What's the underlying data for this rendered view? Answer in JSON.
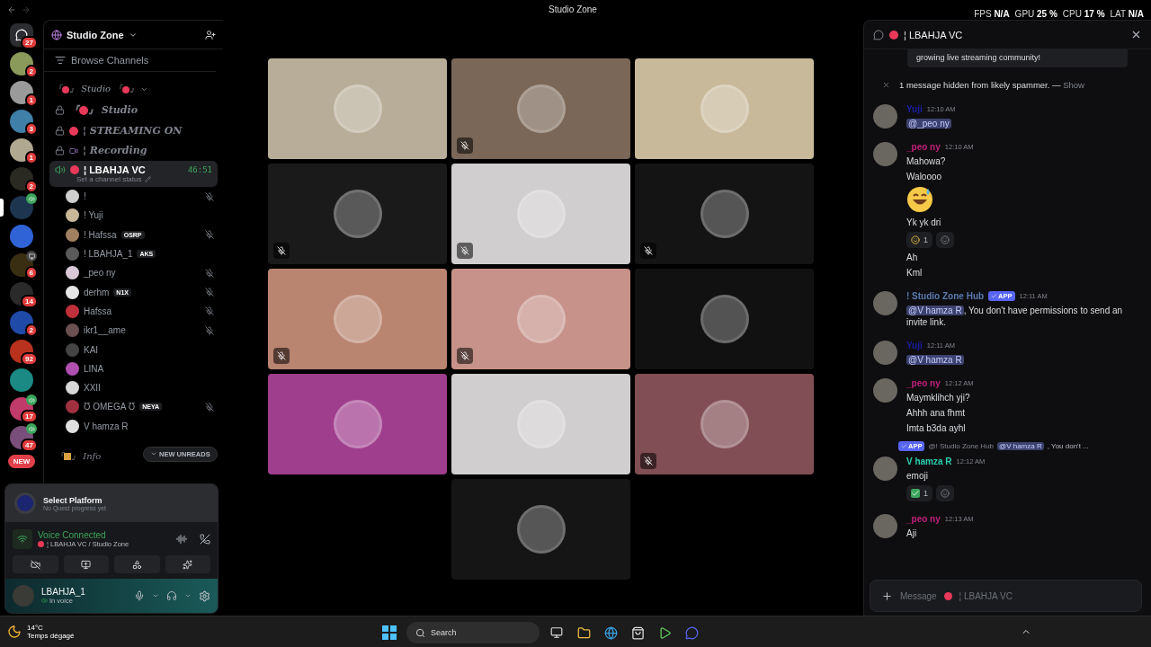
{
  "titlebar": {
    "title": "Studio Zone",
    "stats": [
      {
        "label": "FPS",
        "value": "N/A"
      },
      {
        "label": "GPU",
        "value": "25 %"
      },
      {
        "label": "CPU",
        "value": "17 %"
      },
      {
        "label": "LAT",
        "value": "N/A"
      }
    ]
  },
  "servers": [
    {
      "kind": "home",
      "badge": "27",
      "selected": false,
      "in_voice": false,
      "streaming": false
    },
    {
      "kind": "server",
      "color": "#8a9a5a",
      "badge": "2",
      "selected": false,
      "in_voice": false,
      "streaming": false
    },
    {
      "kind": "server",
      "color": "#9a9a9a",
      "badge": "1",
      "selected": false,
      "in_voice": false,
      "streaming": false
    },
    {
      "kind": "server",
      "color": "#3f7fa8",
      "badge": "3",
      "selected": false,
      "in_voice": false,
      "streaming": false
    },
    {
      "kind": "server",
      "color": "#b0a890",
      "badge": "1",
      "selected": false,
      "in_voice": false,
      "streaming": false
    },
    {
      "kind": "server",
      "color": "#2a2a22",
      "badge": "2",
      "selected": false,
      "in_voice": false,
      "streaming": false
    },
    {
      "kind": "server",
      "color": "#1e3550",
      "selected": true,
      "in_voice": true,
      "streaming": false
    },
    {
      "kind": "server",
      "color": "#2f63d6",
      "selected": false,
      "in_voice": false,
      "streaming": false
    },
    {
      "kind": "server",
      "color": "#3a2e12",
      "badge": "6",
      "selected": false,
      "in_voice": false,
      "streaming": true
    },
    {
      "kind": "server",
      "color": "#2a2a2a",
      "badge": "14",
      "selected": false,
      "in_voice": false,
      "streaming": false
    },
    {
      "kind": "server",
      "color": "#1f4aa8",
      "badge": "2",
      "selected": false,
      "in_voice": false,
      "streaming": false
    },
    {
      "kind": "server",
      "color": "#b8321e",
      "badge": "92",
      "selected": false,
      "in_voice": false,
      "streaming": false
    },
    {
      "kind": "server",
      "color": "#1c8a84",
      "selected": false,
      "in_voice": false,
      "streaming": false
    },
    {
      "kind": "server",
      "color": "#c03a6a",
      "badge": "17",
      "selected": false,
      "in_voice": true,
      "streaming": false
    },
    {
      "kind": "server",
      "color": "#7a4e7a",
      "badge": "47",
      "selected": false,
      "in_voice": true,
      "streaming": false
    }
  ],
  "new_servers_label": "NEW",
  "sidebar": {
    "server_name": "Studio Zone",
    "browse": "Browse Channels",
    "channels": [
      {
        "kind": "category",
        "name": "Studio",
        "brackets": [
          "『",
          "』"
        ],
        "expanded": true
      },
      {
        "kind": "bracketed",
        "locked": true,
        "brackets": [
          "『",
          "』"
        ],
        "name": "Studio"
      },
      {
        "kind": "text",
        "locked": true,
        "separator": "¦",
        "name": "STREAMING ON"
      },
      {
        "kind": "camera",
        "locked": true,
        "separator": "¦",
        "name": "Recording"
      },
      {
        "kind": "voice",
        "separator": "¦",
        "name": "LBAHJA VC",
        "timer": "46:51",
        "status": "Set a channel status",
        "selected": true
      }
    ],
    "members": [
      {
        "name": "!",
        "color": "#cfcfcf",
        "deafened": true
      },
      {
        "name": "! Yuji",
        "color": "#c9b79a",
        "deafened": false
      },
      {
        "name": "! Hafssa",
        "color": "#a08060",
        "tag": "OSRP",
        "deafened": true
      },
      {
        "name": "! LBAHJA_1",
        "color": "#5a5a5a",
        "tag": "AKS",
        "deafened": false
      },
      {
        "name": "_peo ny",
        "color": "#d8c8d8",
        "deafened": true
      },
      {
        "name": "derhm",
        "color": "#e6e6e6",
        "tag": "N1X",
        "deafened": true
      },
      {
        "name": "Hafssa",
        "color": "#c0303a",
        "deafened": true
      },
      {
        "name": "ikr1__ame",
        "color": "#6a5050",
        "deafened": true
      },
      {
        "name": "KAI",
        "color": "#444444",
        "deafened": false
      },
      {
        "name": "LINA",
        "color": "#b050b0",
        "deafened": false
      },
      {
        "name": "XXII",
        "color": "#d8d8d8",
        "deafened": false
      },
      {
        "name": "Ʊ OMEGA Ʊ",
        "color": "#a03040",
        "tag": "NEYA",
        "deafened": true
      },
      {
        "name": "V hamza R",
        "color": "#e0e0e0",
        "deafened": false
      }
    ],
    "info_channel": {
      "brackets": [
        "『",
        "』"
      ],
      "name": "Info"
    },
    "new_unreads": "NEW UNREADS"
  },
  "quest": {
    "title": "Select Platform",
    "subtitle": "No Quest progress yet"
  },
  "voice": {
    "status": "Voice Connected",
    "channel": "¦ LBAHJA VC / Studio Zone"
  },
  "user": {
    "name": "LBAHJA_1",
    "status": "In voice"
  },
  "tiles": [
    {
      "color": "#b8ad98",
      "muted": false
    },
    {
      "color": "#7a6757",
      "muted": true
    },
    {
      "color": "#c8b99a",
      "muted": false
    },
    {
      "color": "#1a1a1a",
      "muted": true
    },
    {
      "color": "#d0cece",
      "muted": true
    },
    {
      "color": "#141414",
      "muted": true
    },
    {
      "color": "#b98470",
      "muted": true
    },
    {
      "color": "#c7928a",
      "muted": true
    },
    {
      "color": "#111111",
      "muted": false
    },
    {
      "color": "#a03e8e",
      "muted": false
    },
    {
      "color": "#d0cecf",
      "muted": false
    },
    {
      "color": "#824e55",
      "muted": true
    },
    {
      "color": "#151515",
      "muted": false
    }
  ],
  "chat": {
    "title": "¦ LBAHJA VC",
    "embed_text": "growing live streaming community!",
    "hidden_notice": "1 message hidden from likely spammer. — ",
    "show_link": "Show",
    "messages": [
      {
        "author": "Yuji",
        "color": "#1c1ca0",
        "time": "12:10 AM",
        "lines": [
          {
            "kind": "mention",
            "mention": "@_peo ny"
          }
        ]
      },
      {
        "author": "_peo ny",
        "color": "#c0207a",
        "time": "12:10 AM",
        "lines": [
          {
            "kind": "text",
            "text": "Mahowa?"
          },
          {
            "kind": "text",
            "text": "Waloooo"
          },
          {
            "kind": "bigemoji"
          },
          {
            "kind": "text",
            "text": "Yk yk dri"
          },
          {
            "kind": "reaction",
            "count": "1",
            "check": false
          },
          {
            "kind": "text",
            "text": "Ah"
          },
          {
            "kind": "text",
            "text": "Kml"
          }
        ]
      },
      {
        "author": "! Studio Zone Hub",
        "color": "#5a7ab0",
        "app": "APP",
        "time": "12:11 AM",
        "lines": [
          {
            "kind": "mention",
            "mention": "@V hamza R",
            "text": ", You don't have permissions to send an invite link."
          }
        ]
      },
      {
        "author": "Yuji",
        "color": "#1c1ca1",
        "time": "12:11 AM",
        "lines": [
          {
            "kind": "mention",
            "mention": "@V hamza R"
          }
        ]
      },
      {
        "author": "_peo ny",
        "color": "#c0207b",
        "time": "12:12 AM",
        "lines": [
          {
            "kind": "text",
            "text": "Maymklihch yji?"
          },
          {
            "kind": "text",
            "text": "Ahhh ana fhmt"
          },
          {
            "kind": "text",
            "text": "Imta b3da ayhl"
          }
        ]
      },
      {
        "author": "V hamza R",
        "color": "#2ad0b0",
        "time": "12:12 AM",
        "reply": {
          "app": "APP",
          "author": "@! Studio Zone Hub",
          "mention": "@V hamza R",
          "text": ", You don't ..."
        },
        "lines": [
          {
            "kind": "text",
            "text": "emoji"
          },
          {
            "kind": "reaction",
            "count": "1",
            "check": true
          }
        ]
      },
      {
        "author": "_peo ny",
        "color": "#c0207c",
        "time": "12:13 AM",
        "lines": [
          {
            "kind": "text",
            "text": "Aji"
          }
        ]
      }
    ],
    "composer": {
      "placeholder": "Message",
      "channel": "¦ LBAHJA VC"
    }
  },
  "taskbar": {
    "temperature": "14°C",
    "weather": "Temps dégagé",
    "search": "Search"
  }
}
